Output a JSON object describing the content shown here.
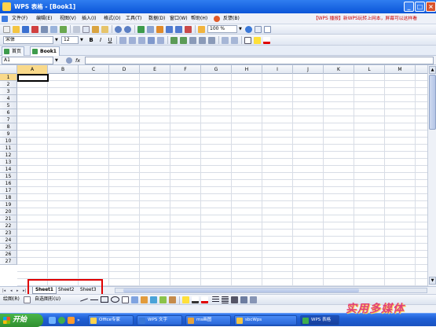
{
  "window": {
    "title": "WPS 表格 - [Book1]",
    "min_glyph": "_",
    "max_glyph": "□",
    "close_glyph": "×"
  },
  "menu": {
    "items": [
      "文件(F)",
      "编辑(E)",
      "视图(V)",
      "插入(I)",
      "格式(O)",
      "工具(T)",
      "数据(D)",
      "窗口(W)",
      "帮助(H)",
      "反馈(B)"
    ],
    "notice": "【WPS 播报】新WPS玩转上网本，屏幕可以这样看"
  },
  "toolbar": {
    "zoom": "100 %"
  },
  "format_toolbar": {
    "font_name": "宋体",
    "font_size": "12",
    "bold": "B",
    "italic": "I",
    "underline": "U"
  },
  "doc_tabs": [
    {
      "label": "首页"
    },
    {
      "label": "Book1"
    }
  ],
  "formula_bar": {
    "name_box": "A1",
    "fx": "fx"
  },
  "grid": {
    "columns": [
      "A",
      "B",
      "C",
      "D",
      "E",
      "F",
      "G",
      "H",
      "I",
      "J",
      "K",
      "L",
      "M"
    ],
    "rows": [
      "1",
      "2",
      "3",
      "4",
      "5",
      "6",
      "7",
      "8",
      "9",
      "10",
      "11",
      "12",
      "13",
      "14",
      "15",
      "16",
      "17",
      "18",
      "19",
      "20",
      "21",
      "22",
      "23",
      "24",
      "25",
      "26",
      "27"
    ],
    "active_cell": "A1"
  },
  "sheets": {
    "nav": [
      "|◂",
      "◂",
      "▸",
      "▸|"
    ],
    "tabs": [
      {
        "label": "Sheet1",
        "active": true
      },
      {
        "label": "Sheet2",
        "active": false
      },
      {
        "label": "Sheet3",
        "active": false
      }
    ]
  },
  "drawing_toolbar": {
    "draw_label": "绘图(R)",
    "autoshapes_label": "自选图形(U)"
  },
  "taskbar": {
    "start_label": "开始",
    "buttons": [
      {
        "label": "Office专家"
      },
      {
        "label": "WPS 文字"
      },
      {
        "label": "ms画图"
      },
      {
        "label": "sbcWps"
      },
      {
        "label": "WPS 表格"
      }
    ]
  },
  "watermark": "实用多媒体",
  "colors": {
    "title_bar": "#0b55d8",
    "highlight": "#f9d98a",
    "annotation_box": "#e00000",
    "taskbar": "#1f5fd4"
  }
}
